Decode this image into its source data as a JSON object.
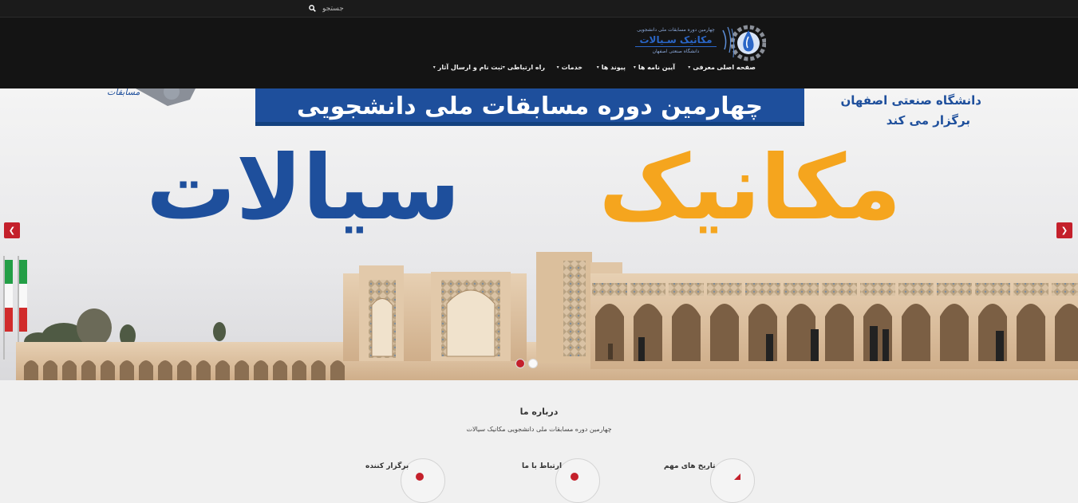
{
  "search": {
    "placeholder": "جستجو",
    "icon": "search-icon"
  },
  "logo": {
    "line1": "چهارمین دوره مسابقات ملی دانشجویی",
    "line2": "مکانیک سـیالات",
    "line3": "دانشگاه صنعتی اصفهان",
    "emblem_text": "مکانیک سیالات"
  },
  "nav": {
    "items": [
      {
        "label": "صفحه اصلی",
        "dropdown": false
      },
      {
        "label": "معرفی",
        "dropdown": true
      },
      {
        "label": "آیین نامه ها",
        "dropdown": true
      },
      {
        "label": "پیوند ها",
        "dropdown": true
      },
      {
        "label": "خدمات",
        "dropdown": true
      },
      {
        "label": "راه ارتباطی",
        "dropdown": true
      },
      {
        "label": "ثبت نام و ارسال آثار",
        "dropdown": true
      }
    ]
  },
  "slide": {
    "banner": "چهارمین دوره مسابقات ملی دانشجویی",
    "host_line1": "دانشگاه صنعتی اصفهان",
    "host_line2": "برگزار می کند",
    "title_orange": "مکانیک",
    "title_blue": "سیالات",
    "corner_logo_text": "مسابقات"
  },
  "slider_controls": {
    "prev_icon": "chevron-left-icon",
    "next_icon": "chevron-right-icon",
    "slides": 2,
    "active_slide": 1
  },
  "about": {
    "title": "درباره ما",
    "subtitle": "چهارمین دوره مسابقات ملی دانشجویی مکانیک سیالات"
  },
  "features": [
    {
      "label": "برگزار کننده",
      "icon": "organizer-icon"
    },
    {
      "label": "ارتباط با ما",
      "icon": "contact-icon"
    },
    {
      "label": "تاریخ های مهم",
      "icon": "calendar-icon"
    }
  ],
  "colors": {
    "accent": "#c4202b",
    "header_bg": "#141414",
    "banner_blue": "#1e4f9c",
    "title_orange": "#f5a51e",
    "title_blue": "#1e4f9c"
  }
}
